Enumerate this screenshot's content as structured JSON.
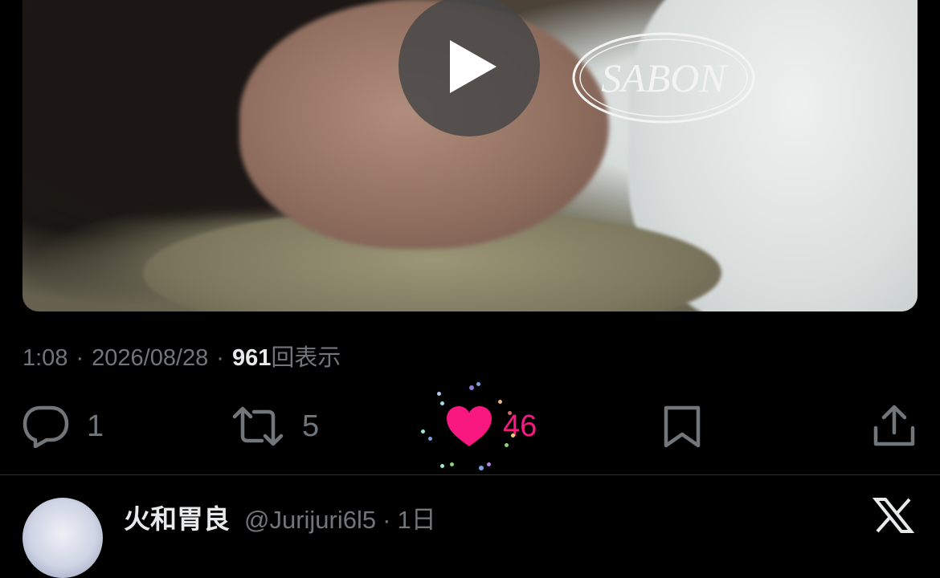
{
  "media": {
    "brand_logo_text": "SABON"
  },
  "post_meta": {
    "time": "1:08",
    "date": "2026/08/28",
    "views_count": "961",
    "views_label": "回表示",
    "separator": "·"
  },
  "actions": {
    "replies": "1",
    "reposts": "5",
    "likes": "46"
  },
  "reply_preview": {
    "display_name": "火和胃良",
    "handle": "@Jurijuri6l5",
    "separator": "·",
    "time_ago": "1日"
  },
  "colors": {
    "background": "#000000",
    "text_primary": "#e7e9ea",
    "text_secondary": "#71767b",
    "like_active": "#f91880"
  },
  "icons": [
    "play-icon",
    "reply-icon",
    "repost-icon",
    "heart-icon",
    "bookmark-icon",
    "share-icon",
    "x-logo-icon"
  ]
}
